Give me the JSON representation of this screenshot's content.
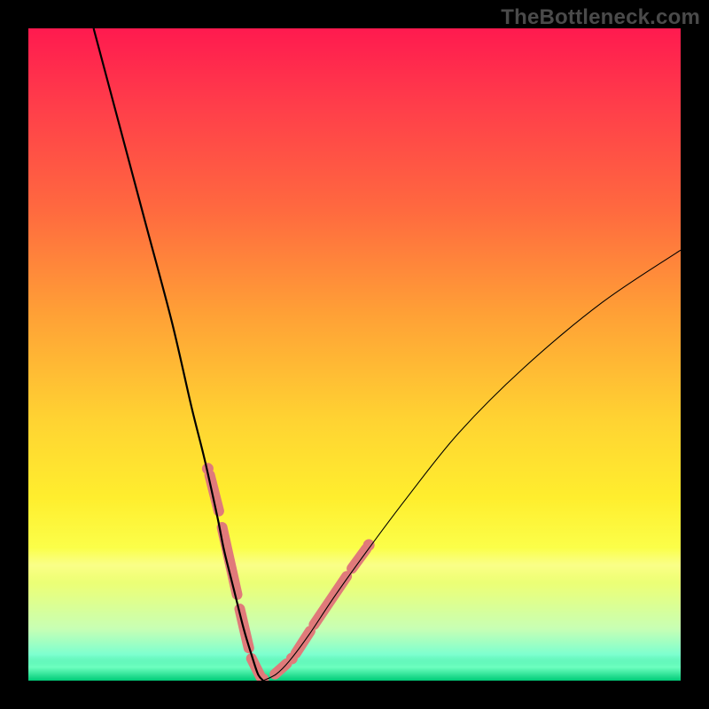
{
  "watermark": "TheBottleneck.com",
  "chart_data": {
    "type": "line",
    "title": "",
    "xlabel": "",
    "ylabel": "",
    "xlim": [
      0,
      100
    ],
    "ylim": [
      0,
      100
    ],
    "grid": false,
    "series": [
      {
        "name": "left-branch",
        "x": [
          10,
          14,
          18,
          22,
          25,
          27,
          29,
          30,
          31.5,
          33,
          34.2,
          35.2,
          36
        ],
        "y": [
          100,
          85,
          70,
          55,
          42,
          34,
          25,
          20,
          14,
          8,
          4,
          1,
          0
        ]
      },
      {
        "name": "right-branch",
        "x": [
          36,
          38,
          40,
          43,
          47,
          52,
          58,
          66,
          76,
          88,
          100
        ],
        "y": [
          0,
          1,
          3,
          7,
          13,
          20,
          28,
          38,
          48,
          58,
          66
        ]
      }
    ],
    "marker_segments_left": [
      {
        "x0": 27.8,
        "y0": 31.5,
        "x1": 29.2,
        "y1": 26.0
      },
      {
        "x0": 29.7,
        "y0": 23.5,
        "x1": 32.0,
        "y1": 13.2
      },
      {
        "x0": 32.4,
        "y0": 11.0,
        "x1": 33.8,
        "y1": 5.0
      },
      {
        "x0": 34.2,
        "y0": 3.4,
        "x1": 35.6,
        "y1": 0.6
      }
    ],
    "marker_segments_right": [
      {
        "x0": 37.8,
        "y0": 1.0,
        "x1": 39.6,
        "y1": 2.6
      },
      {
        "x0": 41.0,
        "y0": 4.2,
        "x1": 43.2,
        "y1": 7.6
      },
      {
        "x0": 43.8,
        "y0": 8.6,
        "x1": 48.8,
        "y1": 16.0
      },
      {
        "x0": 49.6,
        "y0": 17.2,
        "x1": 51.8,
        "y1": 20.2
      }
    ],
    "marker_dots": [
      {
        "x": 27.5,
        "y": 32.5
      },
      {
        "x": 36.0,
        "y": 0.2
      },
      {
        "x": 40.4,
        "y": 3.4
      },
      {
        "x": 52.2,
        "y": 20.8
      }
    ],
    "bands": {
      "acceptable_band_y": [
        15,
        21
      ],
      "ideal_band_y": [
        0,
        4
      ]
    },
    "colors": {
      "gradient_top": "#ff1a4f",
      "gradient_mid": "#ffd332",
      "gradient_bottom": "#00cc78",
      "marker": "#e07a7a",
      "curve": "#000000"
    }
  }
}
